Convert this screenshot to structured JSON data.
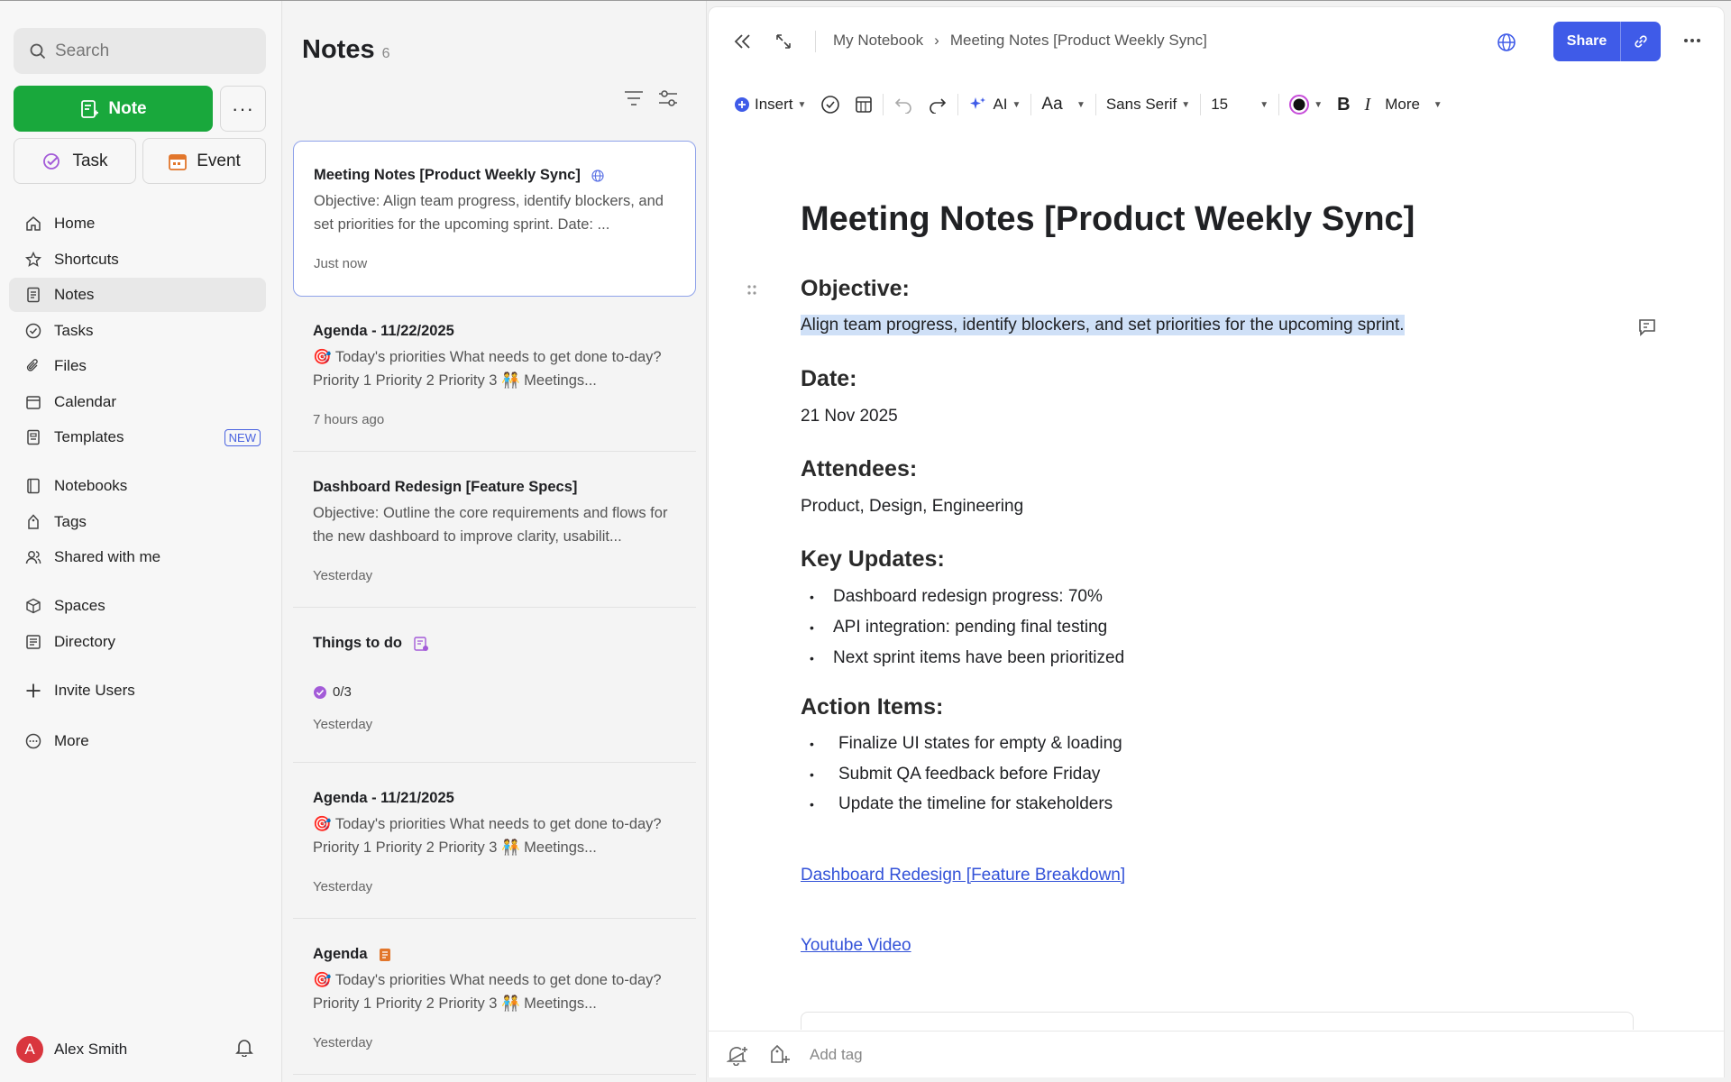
{
  "sidebar": {
    "search_placeholder": "Search",
    "note_button": "Note",
    "more_button": "···",
    "task_button": "Task",
    "event_button": "Event",
    "nav": [
      {
        "label": "Home",
        "icon": "home-icon"
      },
      {
        "label": "Shortcuts",
        "icon": "star-icon"
      },
      {
        "label": "Notes",
        "icon": "note-icon",
        "active": true
      },
      {
        "label": "Tasks",
        "icon": "check-circle-icon"
      },
      {
        "label": "Files",
        "icon": "paperclip-icon"
      },
      {
        "label": "Calendar",
        "icon": "calendar-icon"
      },
      {
        "label": "Templates",
        "icon": "template-icon",
        "badge": "NEW"
      },
      {
        "label": "Notebooks",
        "icon": "notebook-icon"
      },
      {
        "label": "Tags",
        "icon": "tag-icon"
      },
      {
        "label": "Shared with me",
        "icon": "people-icon"
      },
      {
        "label": "Spaces",
        "icon": "cube-icon"
      },
      {
        "label": "Directory",
        "icon": "folder-icon"
      },
      {
        "label": "Invite Users",
        "icon": "plus-icon"
      },
      {
        "label": "More",
        "icon": "more-circle-icon"
      }
    ],
    "user": {
      "initial": "A",
      "name": "Alex Smith"
    }
  },
  "note_list": {
    "title": "Notes",
    "count": "6",
    "cards": [
      {
        "title": "Meeting Notes [Product Weekly Sync]",
        "snippet": "Objective: Align team progress, identify blockers, and set priorities for the upcoming sprint. Date: ...",
        "time": "Just now"
      },
      {
        "title": "Agenda - 11/22/2025",
        "snippet": "🎯 Today's priorities What needs to get done to-day? Priority 1 Priority 2 Priority 3 🧑‍🤝‍🧑 Meetings...",
        "time": "7 hours ago"
      },
      {
        "title": "Dashboard Redesign [Feature Specs]",
        "snippet": "Objective: Outline the core requirements and flows for the new dashboard to improve clarity, usabilit...",
        "time": "Yesterday"
      },
      {
        "title": "Things to do",
        "progress": "0/3",
        "time": "Yesterday"
      },
      {
        "title": "Agenda - 11/21/2025",
        "snippet": "🎯 Today's priorities What needs to get done to-day? Priority 1 Priority 2 Priority 3 🧑‍🤝‍🧑 Meetings...",
        "time": "Yesterday"
      },
      {
        "title": "Agenda",
        "snippet": "🎯 Today's priorities What needs to get done to-day? Priority 1 Priority 2 Priority 3 🧑‍🤝‍🧑 Meetings...",
        "time": "Yesterday"
      }
    ]
  },
  "editor": {
    "breadcrumb": {
      "notebook": "My Notebook",
      "separator": "›",
      "note": "Meeting Notes [Product Weekly Sync]"
    },
    "share_label": "Share",
    "toolbar": {
      "insert": "Insert",
      "ai": "AI",
      "text_style": "Aa",
      "font": "Sans Serif",
      "size": "15",
      "more": "More"
    },
    "doc": {
      "title": "Meeting Notes [Product Weekly Sync]",
      "objective_h": "Objective:",
      "objective": "Align team progress, identify blockers, and set priorities for the upcoming sprint.",
      "date_h": "Date:",
      "date": "21 Nov 2025",
      "attendees_h": "Attendees:",
      "attendees": "Product, Design, Engineering",
      "updates_h": "Key Updates:",
      "updates": [
        "Dashboard redesign progress: 70%",
        "API integration: pending final testing",
        "Next sprint items have been prioritized"
      ],
      "actions_h": "Action Items:",
      "actions": [
        "Finalize UI states for empty & loading",
        "Submit QA feedback before Friday",
        "Update the timeline for stakeholders"
      ],
      "link1": "Dashboard Redesign [Feature Breakdown]",
      "link2": "Youtube Video"
    },
    "footer": {
      "add_tag_placeholder": "Add tag"
    }
  },
  "colors": {
    "primary_green": "#19a83c",
    "accent_blue": "#3f5be8",
    "link_blue": "#3352d8",
    "highlight": "#cfe0f7"
  }
}
